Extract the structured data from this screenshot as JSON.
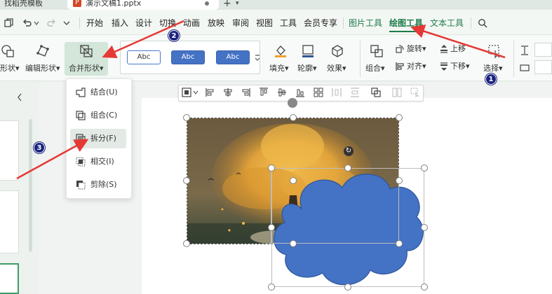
{
  "tabs": {
    "template": "找稻壳模板",
    "document": "演示文稿1.pptx",
    "doc_icon": "P",
    "close_glyph": "×",
    "plus": "+",
    "plus_arrow": "▾"
  },
  "quick_access": {
    "icons": [
      "copy-icon",
      "undo-icon",
      "redo-icon",
      "dropdown-icon"
    ]
  },
  "menu": {
    "items": [
      "开始",
      "插入",
      "设计",
      "切换",
      "动画",
      "放映",
      "审阅",
      "视图",
      "工具",
      "会员专享"
    ],
    "context_tabs": [
      "图片工具",
      "绘图工具",
      "文本工具"
    ],
    "active_tab": "绘图工具"
  },
  "ribbon": {
    "shape_label": "形状",
    "edit_shape_label": "编辑形状",
    "merge_label": "合并形状",
    "style_chips": [
      "Abc",
      "Abc",
      "Abc"
    ],
    "fill_label": "填充",
    "outline_label": "轮廓",
    "effect_label": "效果",
    "group_label": "组合",
    "rotate_label": "旋转",
    "align_label": "对齐",
    "up_label": "上移",
    "down_label": "下移",
    "select_label": "选择",
    "caret": "▾"
  },
  "merge_menu": {
    "items": [
      {
        "label": "结合(U)",
        "icon": "union-icon"
      },
      {
        "label": "组合(C)",
        "icon": "combine-icon"
      },
      {
        "label": "拆分(F)",
        "icon": "fragment-icon"
      },
      {
        "label": "相交(I)",
        "icon": "intersect-icon"
      },
      {
        "label": "剪除(S)",
        "icon": "subtract-icon"
      }
    ],
    "highlighted": "拆分(F)"
  },
  "annotations": {
    "badges": [
      "1",
      "2",
      "3"
    ],
    "arrow_color": "#e53935",
    "badge_color": "#1a237e"
  },
  "colors": {
    "accent": "#1e7b4a",
    "cloud": "#4472c4",
    "menu_highlight": "#e3eae5"
  }
}
